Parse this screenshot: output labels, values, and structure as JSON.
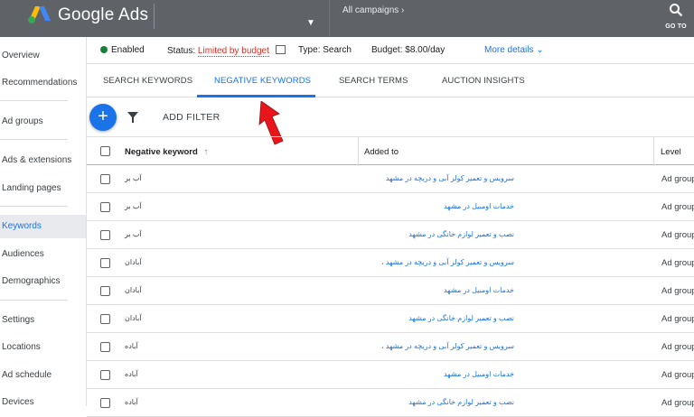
{
  "header": {
    "brand": "Google Ads",
    "breadcrumb": "All campaigns",
    "goto_label": "GO TO"
  },
  "sidebar": {
    "items": [
      {
        "label": "Overview"
      },
      {
        "label": "Recommendations"
      },
      {
        "label": "Ad groups"
      },
      {
        "label": "Ads & extensions"
      },
      {
        "label": "Landing pages"
      },
      {
        "label": "Keywords"
      },
      {
        "label": "Audiences"
      },
      {
        "label": "Demographics"
      },
      {
        "label": "Settings"
      },
      {
        "label": "Locations"
      },
      {
        "label": "Ad schedule"
      },
      {
        "label": "Devices"
      }
    ],
    "active": "Keywords"
  },
  "status": {
    "state": "Enabled",
    "status_label": "Status:",
    "status_value": "Limited by budget",
    "type_label": "Type:",
    "type_value": "Search",
    "budget_label": "Budget:",
    "budget_value": "$8.00/day",
    "more_details": "More details"
  },
  "tabs": [
    {
      "label": "SEARCH KEYWORDS"
    },
    {
      "label": "NEGATIVE KEYWORDS",
      "active": true
    },
    {
      "label": "SEARCH TERMS"
    },
    {
      "label": "AUCTION INSIGHTS"
    }
  ],
  "toolbar": {
    "add_label": "+",
    "add_filter": "ADD FILTER"
  },
  "table": {
    "columns": [
      "Negative keyword",
      "Added to",
      "Level"
    ],
    "rows": [
      {
        "keyword": "آب بر",
        "added_to": "سرویس و تعمیر کولر آبی و دریچه در مشهد",
        "level": "Ad group"
      },
      {
        "keyword": "آب بر",
        "added_to": "خدمات اومبیل در مشهد",
        "level": "Ad group"
      },
      {
        "keyword": "آب بر",
        "added_to": "نصب و تعمیر لوازم خانگی در مشهد",
        "level": "Ad group"
      },
      {
        "keyword": "آبادان",
        "added_to": "سرویس و تعمیر کولر آبی و دریچه در مشهد ،",
        "level": "Ad group"
      },
      {
        "keyword": "آبادان",
        "added_to": "خدمات اومبیل در مشهد",
        "level": "Ad group"
      },
      {
        "keyword": "آبادان",
        "added_to": "نصب و تعمیر لوازم خانگی در مشهد",
        "level": "Ad group"
      },
      {
        "keyword": "آباده",
        "added_to": "سرویس و تعمیر کولر آبی و دریچه در مشهد ،",
        "level": "Ad group"
      },
      {
        "keyword": "آباده",
        "added_to": "خدمات اومبیل در مشهد",
        "level": "Ad group"
      },
      {
        "keyword": "آباده",
        "added_to": "نصب و تعمیر لوازم خانگی در مشهد",
        "level": "Ad group"
      }
    ]
  },
  "colors": {
    "topbar": "#5f6368",
    "accent": "#1a73e8",
    "limited": "#d93025",
    "enabled": "#188038",
    "annotation_arrow": "#e8151b"
  }
}
